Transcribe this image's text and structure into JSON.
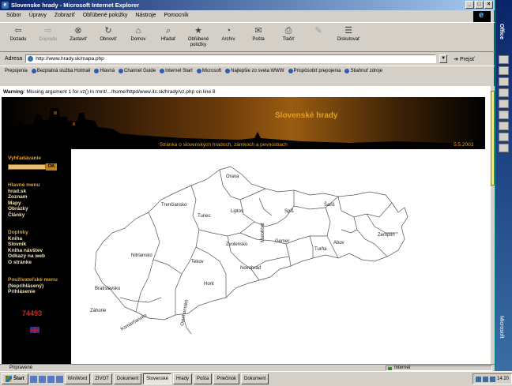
{
  "window": {
    "title": "Slovenske hrady - Microsoft Internet Explorer",
    "controls": [
      "_",
      "□",
      "×"
    ]
  },
  "menu": [
    "Súbor",
    "Úpravy",
    "Zobraziť",
    "Obľúbené položky",
    "Nástroje",
    "Pomocník"
  ],
  "toolbar": [
    {
      "label": "Dozadu",
      "icon": "back-arrow-icon",
      "glyph": "⇦",
      "enabled": true
    },
    {
      "label": "Dopredu",
      "icon": "forward-arrow-icon",
      "glyph": "⇨",
      "enabled": false
    },
    {
      "label": "Zastaviť",
      "icon": "stop-icon",
      "glyph": "⊗",
      "enabled": true
    },
    {
      "label": "Obnoviť",
      "icon": "refresh-icon",
      "glyph": "↻",
      "enabled": true
    },
    {
      "label": "Domov",
      "icon": "home-icon",
      "glyph": "⌂",
      "enabled": true
    },
    {
      "label": "Hľadať",
      "icon": "search-icon",
      "glyph": "⌕",
      "enabled": true
    },
    {
      "label": "Obľúbené položky",
      "icon": "favorites-icon",
      "glyph": "★",
      "enabled": true
    },
    {
      "label": "Archív",
      "icon": "history-icon",
      "glyph": "◔",
      "enabled": true
    },
    {
      "label": "Pošta",
      "icon": "mail-icon",
      "glyph": "✉",
      "enabled": true
    },
    {
      "label": "Tlačiť",
      "icon": "print-icon",
      "glyph": "⎙",
      "enabled": true
    },
    {
      "label": "",
      "icon": "edit-icon",
      "glyph": "✎",
      "enabled": false
    },
    {
      "label": "Diskutovať",
      "icon": "discuss-icon",
      "glyph": "☰",
      "enabled": true
    }
  ],
  "address": {
    "label": "Adresa",
    "value": "http://www.hrady.sk/mapa.php",
    "go": "Prejsť"
  },
  "links": [
    "Prepojenia",
    "Bezplatná služba Hotmail",
    "Hlavná",
    "Channel Guide",
    "Internet Start",
    "Microsoft",
    "Najlepšie zo sveta WWW",
    "Prispôsobiť prepojenia",
    "Stiahnuť zdroje"
  ],
  "warning": {
    "prefix": "Warning",
    "text": ": Missing argument 1 for vz() in /mnt/.../home/httpd/www.itc.sk/hrady/vz.php on line 8"
  },
  "banner": {
    "title": "Slovenské hrady",
    "subtitle": "Stránka o slovenských hradoch, zámkoch a pevnostiach",
    "date": "5.5.2003"
  },
  "sidebar": {
    "search_label": "Vyhľadávanie",
    "search_button": "OK",
    "menu1": [
      "Hlavné menu",
      "hrad.sk",
      "Zoznam",
      "Mapy",
      "Obrázky",
      "Články"
    ],
    "menu2": [
      "Doplnky",
      "Kniha",
      "Slovník",
      "Kniha návštev",
      "Odkazy na web",
      "O stránke"
    ],
    "menu3": [
      "Používateľské menu",
      "(Neprihlásený)",
      "Prihlásenie"
    ],
    "counter": "74493"
  },
  "map": {
    "regions": [
      "Orava",
      "Trenčiansko",
      "Turiec",
      "Liptov",
      "Spiš",
      "Šariš",
      "Zemplín",
      "Abov",
      "Turňa",
      "Gemer",
      "Malohont",
      "Novohrad",
      "Zvolensko",
      "Tekov",
      "Hont",
      "Nitriansko",
      "Bratislavsko",
      "Záhorie",
      "Komárňansko",
      "Ostrihomsko"
    ]
  },
  "statusbar": {
    "left": "Pripravené",
    "zone": "Internet"
  },
  "taskbar": {
    "start": "Štart",
    "tasks": [
      "WinWord",
      "ZIVOT",
      "Dokument",
      "Slovenské",
      "Hrady",
      "Pošta",
      "Priečinok",
      "Dokument"
    ],
    "active_index": 3,
    "clock": "14:20"
  },
  "office": {
    "title": "Office",
    "brand": "Microsoft"
  }
}
